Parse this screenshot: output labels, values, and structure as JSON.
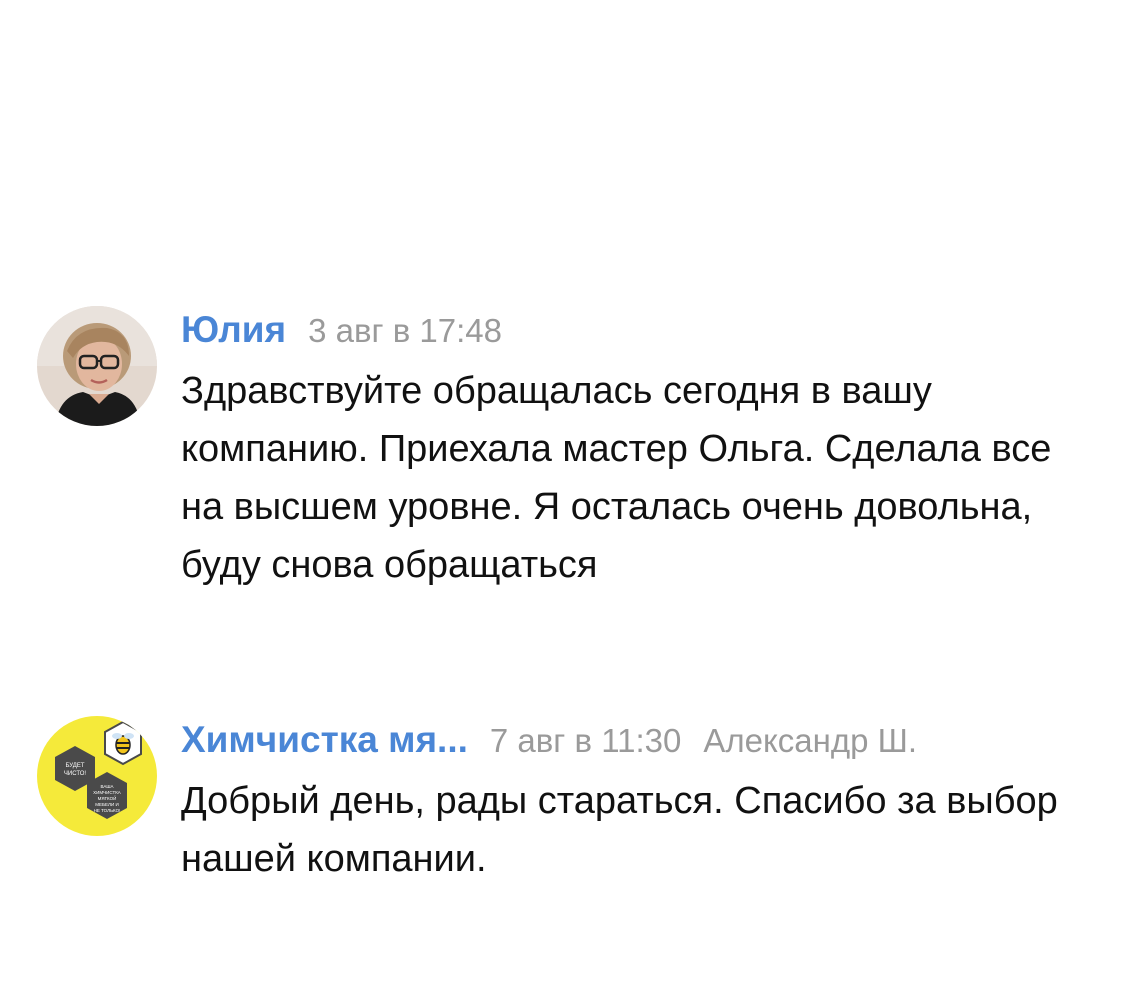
{
  "comments": [
    {
      "author": "Юлия",
      "date": "3 авг в 17:48",
      "text": "Здравствуйте обращалась сегодня в вашу компанию. Приехала мастер Ольга. Сделала все на высшем уровне. Я осталась очень довольна, буду снова обращаться",
      "avatar_icon": "user-photo",
      "avatar_bg": "#d9c9bb"
    },
    {
      "author": "Химчистка мя...",
      "date": "7 авг в 11:30",
      "replier": "Александр Ш.",
      "text": "Добрый день, рады стараться. Спасибо за выбор нашей компании.",
      "avatar_icon": "company-logo",
      "avatar_bg": "#f5ea3a",
      "logo_text": {
        "left": [
          "БУДЕТ",
          "ЧИСТО!"
        ],
        "bottom": [
          "ВАША",
          "ХИМЧИСТКА",
          "МЯГКОЙ",
          "МЕБЕЛИ И",
          "НЕ ТОЛЬКО!"
        ]
      }
    }
  ],
  "colors": {
    "author": "#4a86d6",
    "meta": "#9a9a9a",
    "text": "#111111"
  }
}
